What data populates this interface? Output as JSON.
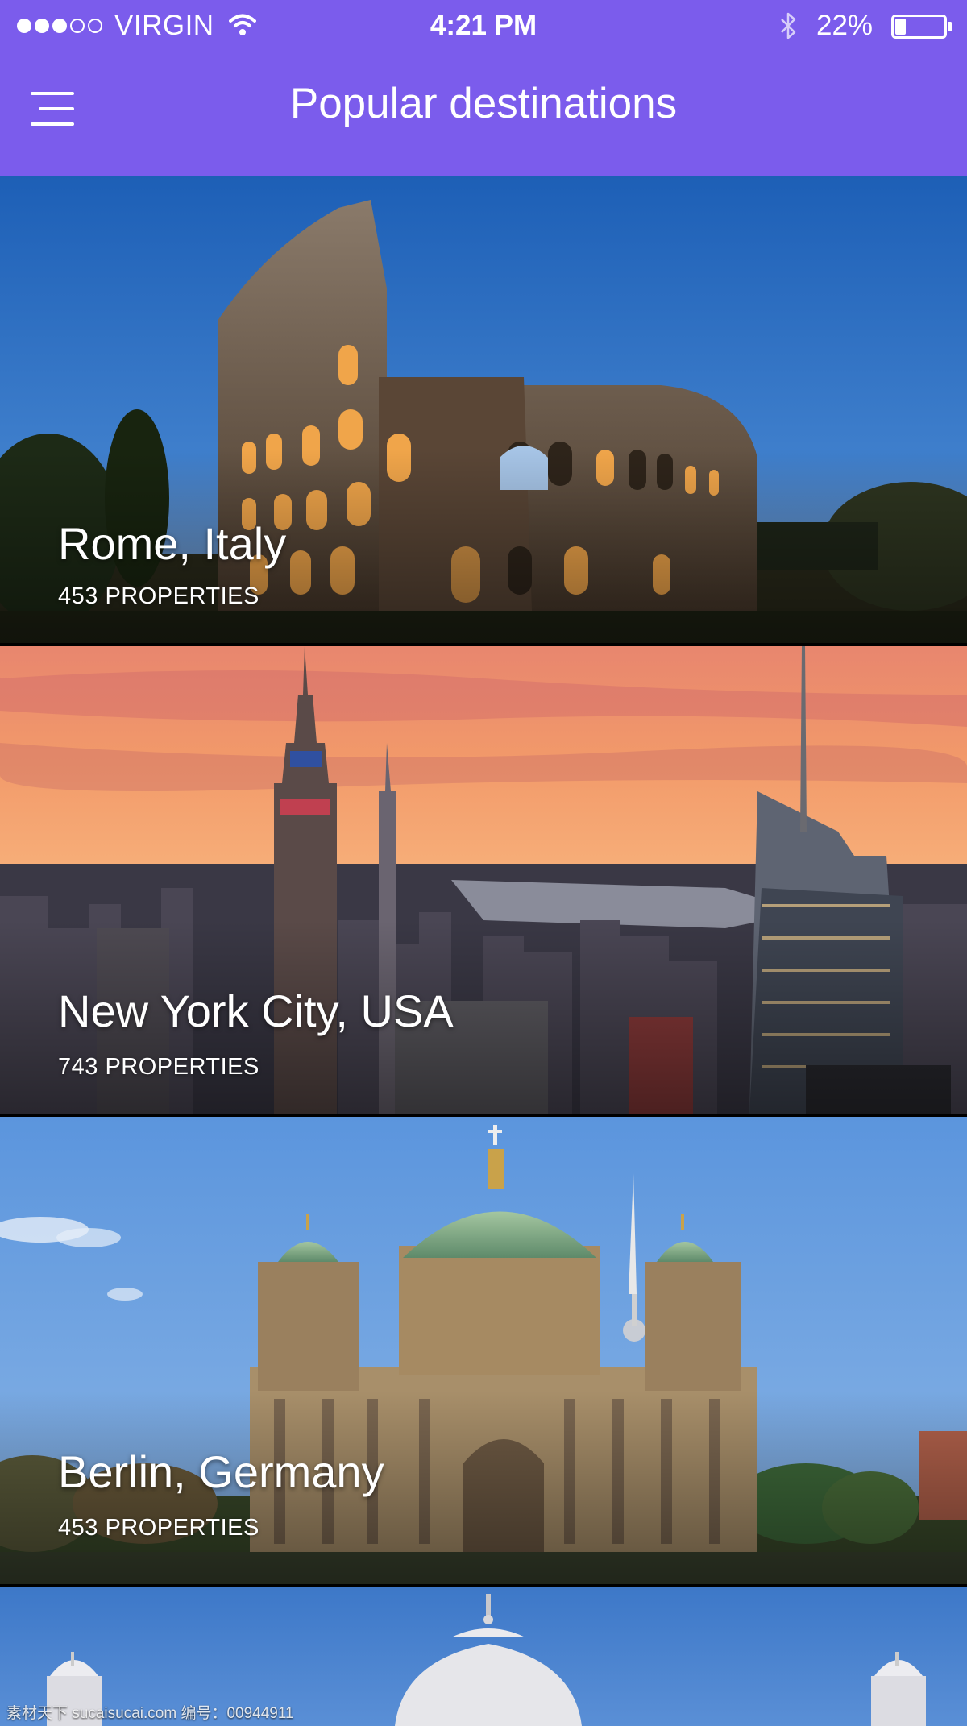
{
  "status_bar": {
    "carrier": "VIRGIN",
    "time": "4:21 PM",
    "battery_percent": "22%",
    "battery_level": 0.22,
    "signal_bars_filled": 3,
    "signal_bars_total": 5,
    "icons": [
      "signal-dots-icon",
      "wifi-icon",
      "bluetooth-icon",
      "battery-icon"
    ]
  },
  "header": {
    "title": "Popular destinations",
    "menu_icon": "hamburger-menu-icon",
    "background": "#7b5cec"
  },
  "destinations": [
    {
      "city": "Rome, Italy",
      "properties": "453 PROPERTIES"
    },
    {
      "city": "New York City, USA",
      "properties": "743 PROPERTIES"
    },
    {
      "city": "Berlin, Germany",
      "properties": "453 PROPERTIES"
    },
    {
      "city": "",
      "properties": ""
    }
  ],
  "watermark": "素材天下 sucaisucai.com  编号：00944911"
}
